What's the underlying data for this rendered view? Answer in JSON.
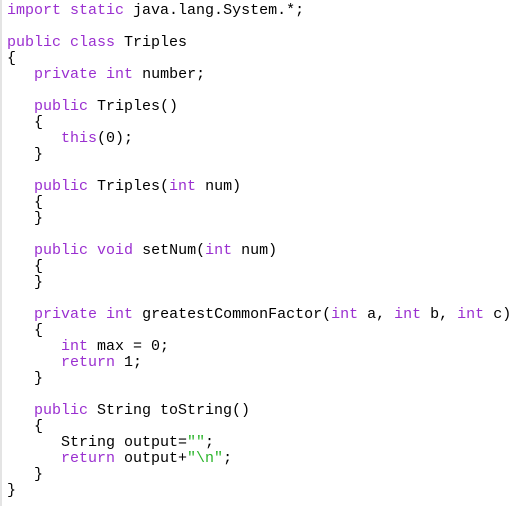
{
  "colors": {
    "keyword": "#9a2fd0",
    "string": "#2bb52b",
    "text": "#000000",
    "background": "#ffffff"
  },
  "code": {
    "language": "java",
    "lines": [
      [
        {
          "t": "kw",
          "v": "import"
        },
        {
          "t": "plain",
          "v": " "
        },
        {
          "t": "kw",
          "v": "static"
        },
        {
          "t": "plain",
          "v": " java.lang.System.*;"
        }
      ],
      [],
      [
        {
          "t": "kw",
          "v": "public"
        },
        {
          "t": "plain",
          "v": " "
        },
        {
          "t": "kw",
          "v": "class"
        },
        {
          "t": "plain",
          "v": " Triples"
        }
      ],
      [
        {
          "t": "plain",
          "v": "{"
        }
      ],
      [
        {
          "t": "plain",
          "v": "   "
        },
        {
          "t": "kw",
          "v": "private"
        },
        {
          "t": "plain",
          "v": " "
        },
        {
          "t": "kw",
          "v": "int"
        },
        {
          "t": "plain",
          "v": " number;"
        }
      ],
      [],
      [
        {
          "t": "plain",
          "v": "   "
        },
        {
          "t": "kw",
          "v": "public"
        },
        {
          "t": "plain",
          "v": " Triples()"
        }
      ],
      [
        {
          "t": "plain",
          "v": "   {"
        }
      ],
      [
        {
          "t": "plain",
          "v": "      "
        },
        {
          "t": "kw",
          "v": "this"
        },
        {
          "t": "plain",
          "v": "(0);"
        }
      ],
      [
        {
          "t": "plain",
          "v": "   }"
        }
      ],
      [],
      [
        {
          "t": "plain",
          "v": "   "
        },
        {
          "t": "kw",
          "v": "public"
        },
        {
          "t": "plain",
          "v": " Triples("
        },
        {
          "t": "kw",
          "v": "int"
        },
        {
          "t": "plain",
          "v": " num)"
        }
      ],
      [
        {
          "t": "plain",
          "v": "   {"
        }
      ],
      [
        {
          "t": "plain",
          "v": "   }"
        }
      ],
      [],
      [
        {
          "t": "plain",
          "v": "   "
        },
        {
          "t": "kw",
          "v": "public"
        },
        {
          "t": "plain",
          "v": " "
        },
        {
          "t": "kw",
          "v": "void"
        },
        {
          "t": "plain",
          "v": " setNum("
        },
        {
          "t": "kw",
          "v": "int"
        },
        {
          "t": "plain",
          "v": " num)"
        }
      ],
      [
        {
          "t": "plain",
          "v": "   {"
        }
      ],
      [
        {
          "t": "plain",
          "v": "   }"
        }
      ],
      [],
      [
        {
          "t": "plain",
          "v": "   "
        },
        {
          "t": "kw",
          "v": "private"
        },
        {
          "t": "plain",
          "v": " "
        },
        {
          "t": "kw",
          "v": "int"
        },
        {
          "t": "plain",
          "v": " greatestCommonFactor("
        },
        {
          "t": "kw",
          "v": "int"
        },
        {
          "t": "plain",
          "v": " a, "
        },
        {
          "t": "kw",
          "v": "int"
        },
        {
          "t": "plain",
          "v": " b, "
        },
        {
          "t": "kw",
          "v": "int"
        },
        {
          "t": "plain",
          "v": " c)"
        }
      ],
      [
        {
          "t": "plain",
          "v": "   {"
        }
      ],
      [
        {
          "t": "plain",
          "v": "      "
        },
        {
          "t": "kw",
          "v": "int"
        },
        {
          "t": "plain",
          "v": " max = 0;"
        }
      ],
      [
        {
          "t": "plain",
          "v": "      "
        },
        {
          "t": "kw",
          "v": "return"
        },
        {
          "t": "plain",
          "v": " 1;"
        }
      ],
      [
        {
          "t": "plain",
          "v": "   }"
        }
      ],
      [],
      [
        {
          "t": "plain",
          "v": "   "
        },
        {
          "t": "kw",
          "v": "public"
        },
        {
          "t": "plain",
          "v": " String toString()"
        }
      ],
      [
        {
          "t": "plain",
          "v": "   {"
        }
      ],
      [
        {
          "t": "plain",
          "v": "      String output="
        },
        {
          "t": "str",
          "v": "\"\""
        },
        {
          "t": "plain",
          "v": ";"
        }
      ],
      [
        {
          "t": "plain",
          "v": "      "
        },
        {
          "t": "kw",
          "v": "return"
        },
        {
          "t": "plain",
          "v": " output+"
        },
        {
          "t": "str",
          "v": "\"\\n\""
        },
        {
          "t": "plain",
          "v": ";"
        }
      ],
      [
        {
          "t": "plain",
          "v": "   }"
        }
      ],
      [
        {
          "t": "plain",
          "v": "}"
        }
      ]
    ]
  }
}
